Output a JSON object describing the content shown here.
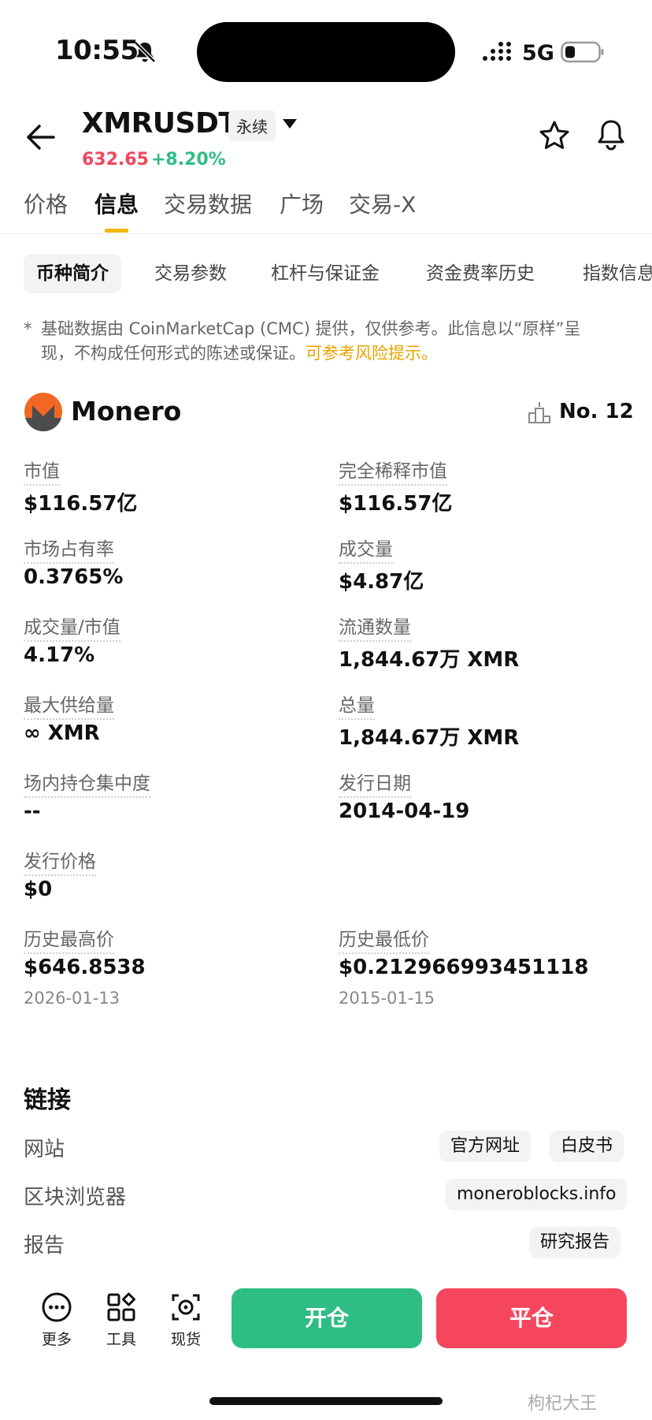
{
  "status_bar": {
    "time": "10:55",
    "network": "5G"
  },
  "header": {
    "pair": "XMRUSDT",
    "contract_type": "永续",
    "price": "632.65",
    "change": "+8.20%",
    "colors": {
      "down": "#f0465e",
      "up": "#2ebd85",
      "accent": "#f0b90b"
    }
  },
  "tabs": [
    {
      "label": "价格"
    },
    {
      "label": "信息",
      "active": true
    },
    {
      "label": "交易数据"
    },
    {
      "label": "广场"
    },
    {
      "label": "交易-X"
    }
  ],
  "subtabs": [
    {
      "label": "币种简介",
      "active": true
    },
    {
      "label": "交易参数"
    },
    {
      "label": "杠杆与保证金"
    },
    {
      "label": "资金费率历史"
    },
    {
      "label": "指数信息"
    }
  ],
  "disclaimer": {
    "mark": "*",
    "text": "基础数据由 CoinMarketCap (CMC) 提供，仅供参考。此信息以“原样”呈现，不构成任何形式的陈述或保证。",
    "link": "可参考风险提示。"
  },
  "coin": {
    "name": "Monero",
    "rank": "No. 12",
    "icon": "monero-logo-icon"
  },
  "stats": [
    {
      "label": "市值",
      "value": "$116.57亿"
    },
    {
      "label": "完全稀释市值",
      "value": "$116.57亿"
    },
    {
      "label": "市场占有率",
      "value": "0.3765%"
    },
    {
      "label": "成交量",
      "value": "$4.87亿"
    },
    {
      "label": "成交量/市值",
      "value": "4.17%"
    },
    {
      "label": "流通数量",
      "value": "1,844.67万 XMR"
    },
    {
      "label": "最大供给量",
      "value": "∞ XMR"
    },
    {
      "label": "总量",
      "value": "1,844.67万 XMR"
    },
    {
      "label": "场内持仓集中度",
      "value": "--"
    },
    {
      "label": "发行日期",
      "value": "2014-04-19"
    },
    {
      "label": "发行价格",
      "value": "$0"
    },
    {
      "label": "历史最高价",
      "value": "$646.8538",
      "date": "2026-01-13"
    },
    {
      "label": "历史最低价",
      "value": "$0.212966993451118",
      "date": "2015-01-15"
    }
  ],
  "links": {
    "title": "链接",
    "rows": [
      {
        "label": "网站",
        "chips": [
          "官方网址",
          "白皮书"
        ]
      },
      {
        "label": "区块浏览器",
        "chips": [
          "moneroblocks.info"
        ]
      },
      {
        "label": "报告",
        "chips": [
          "研究报告"
        ]
      }
    ]
  },
  "bottom_bar": {
    "tools": [
      {
        "label": "更多",
        "icon": "more-icon"
      },
      {
        "label": "工具",
        "icon": "tools-icon"
      },
      {
        "label": "现货",
        "icon": "spot-icon"
      }
    ],
    "open_label": "开仓",
    "close_label": "平仓"
  },
  "watermark": "枸杞大王"
}
